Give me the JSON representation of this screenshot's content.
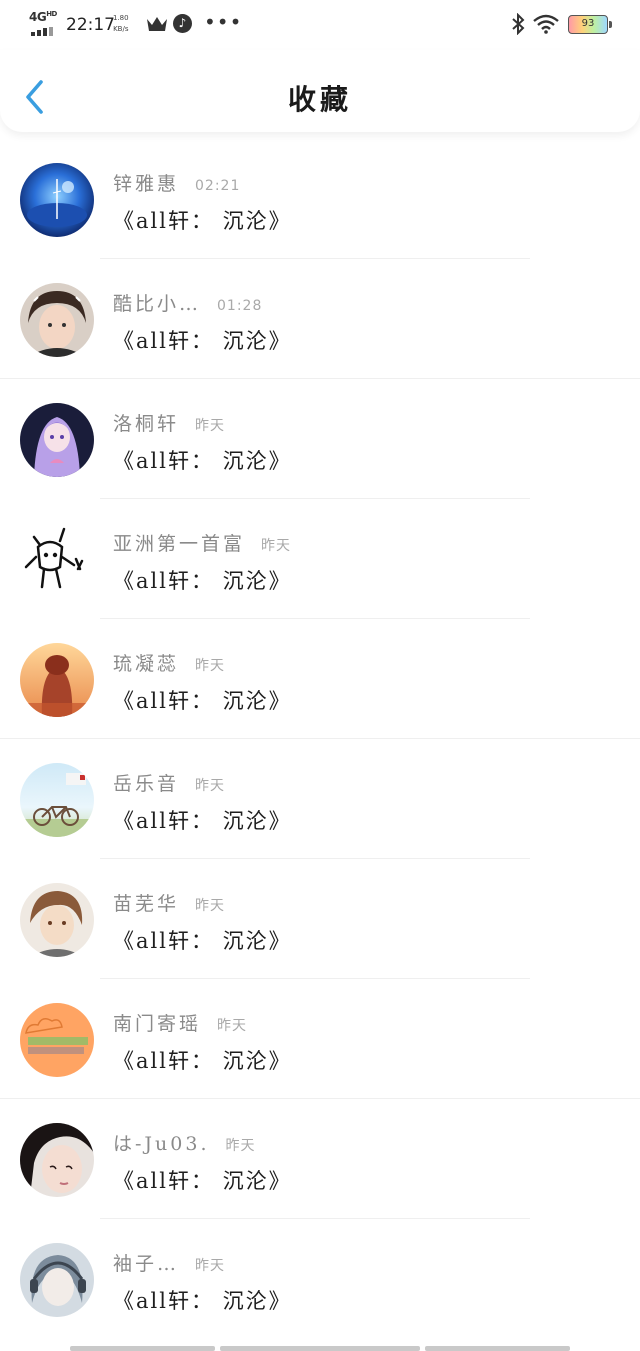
{
  "status_bar": {
    "network": "4G",
    "network_sup": "HD",
    "time": "22:17",
    "speed_value": "1.80",
    "speed_unit": "KB/s",
    "battery": "93",
    "icons": [
      "signal-icon",
      "crown-icon",
      "music-icon",
      "more-dots-icon",
      "bluetooth-icon",
      "wifi-icon",
      "battery-icon"
    ]
  },
  "header": {
    "title": "收藏",
    "back_icon": "chevron-left-icon",
    "accent_color": "#3a9ee0"
  },
  "items": [
    {
      "name": "锌雅惠",
      "time": "02:21",
      "title": "《all轩： 沉沦》"
    },
    {
      "name": "酷比小…",
      "time": "01:28",
      "title": "《all轩： 沉沦》"
    },
    {
      "name": "洛桐轩",
      "time": "昨天",
      "title": "《all轩： 沉沦》"
    },
    {
      "name": "亚洲第一首富",
      "time": "昨天",
      "title": "《all轩： 沉沦》"
    },
    {
      "name": "琉凝蕊",
      "time": "昨天",
      "title": "《all轩： 沉沦》"
    },
    {
      "name": "岳乐音",
      "time": "昨天",
      "title": "《all轩： 沉沦》"
    },
    {
      "name": "苗芜华",
      "time": "昨天",
      "title": "《all轩： 沉沦》"
    },
    {
      "name": "南门寄瑶",
      "time": "昨天",
      "title": "《all轩： 沉沦》"
    },
    {
      "name": "は-Ju03.",
      "time": "昨天",
      "title": "《all轩： 沉沦》"
    },
    {
      "name": "袖子…",
      "time": "昨天",
      "title": "《all轩： 沉沦》"
    }
  ]
}
